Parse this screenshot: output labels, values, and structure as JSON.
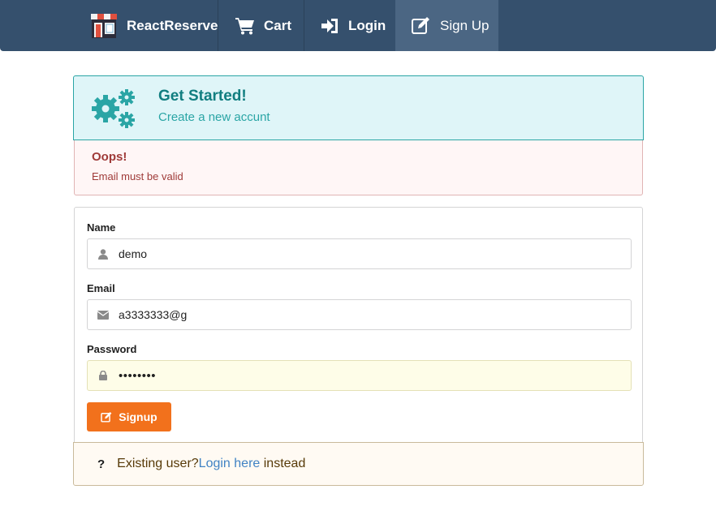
{
  "nav": {
    "brand": "ReactReserve",
    "cart": "Cart",
    "login": "Login",
    "signup": "Sign Up"
  },
  "header": {
    "title": "Get Started!",
    "subtitle": "Create a new accunt"
  },
  "error": {
    "title": "Oops!",
    "message": "Email must be valid"
  },
  "form": {
    "name_label": "Name",
    "name_value": "demo",
    "email_label": "Email",
    "email_value": "a3333333@g",
    "password_label": "Password",
    "password_mask": "••••••••",
    "submit_label": "Signup"
  },
  "footer": {
    "question_icon": "?",
    "prefix": "Existing user?",
    "link": "Login here",
    "suffix": " instead"
  },
  "colors": {
    "nav": "#35506d",
    "teal": "#117e80",
    "error": "#9f3a38",
    "button": "#f2711c",
    "link": "#4183c4"
  }
}
